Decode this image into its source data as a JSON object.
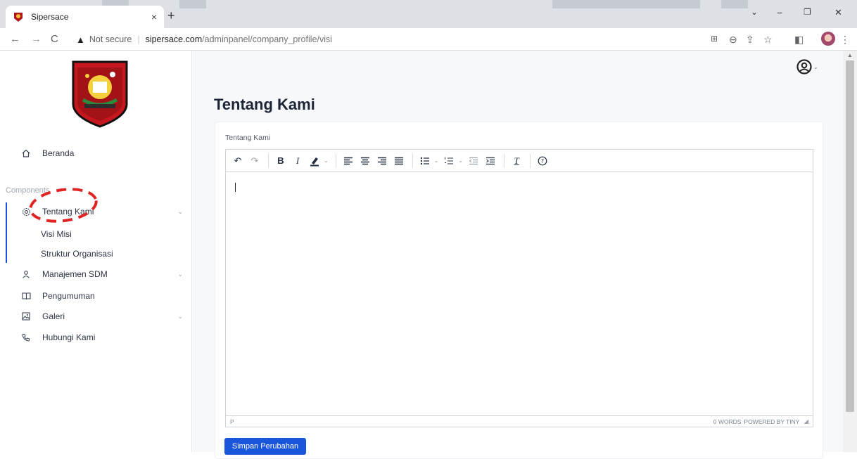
{
  "browser": {
    "tab_title": "Sipersace",
    "tab_close": "×",
    "new_tab": "+",
    "win_min": "⌄",
    "win_minimize": "−",
    "win_restore": "❐",
    "win_close": "✕",
    "security_label": "Not secure",
    "url_host": "sipersace.com",
    "url_path": "/adminpanel/company_profile/visi"
  },
  "sidebar": {
    "home_label": "Beranda",
    "section_label": "Components",
    "items": [
      {
        "label": "Tentang Kami",
        "icon": "gear-icon",
        "has_chevron": true
      },
      {
        "label": "Manajemen SDM",
        "icon": "user-icon",
        "has_chevron": true
      },
      {
        "label": "Pengumuman",
        "icon": "book-icon",
        "has_chevron": false
      },
      {
        "label": "Galeri",
        "icon": "image-icon",
        "has_chevron": true
      },
      {
        "label": "Hubungi Kami",
        "icon": "phone-icon",
        "has_chevron": false
      }
    ],
    "submenu": [
      "Visi Misi",
      "Struktur Organisasi"
    ]
  },
  "main": {
    "page_title": "Tentang Kami",
    "field_label": "Tentang Kami",
    "editor": {
      "status_path": "P",
      "word_count": "0 WORDS",
      "powered_by": "POWERED BY TINY"
    },
    "save_label": "Simpan Perubahan"
  },
  "colors": {
    "accent": "#1a56db",
    "annotation": "#e02424"
  }
}
